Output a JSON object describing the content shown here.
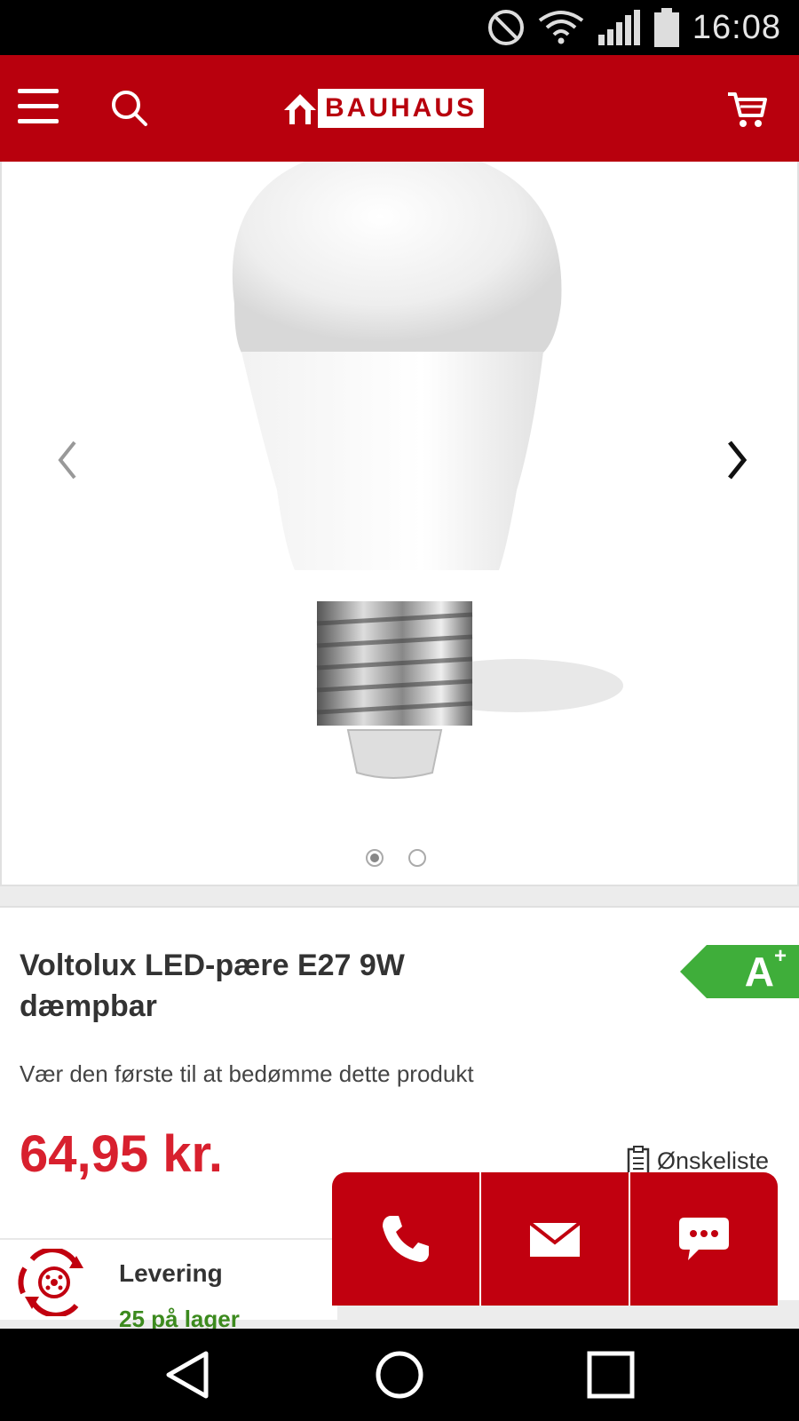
{
  "status_bar": {
    "time": "16:08",
    "icons": [
      "do-not-disturb-icon",
      "wifi-icon",
      "signal-icon",
      "battery-icon"
    ]
  },
  "header": {
    "brand": "BAUHAUS",
    "brand_color": "#b8000d",
    "icons": [
      "menu-icon",
      "search-icon",
      "cart-icon"
    ]
  },
  "carousel": {
    "current_slide": 1,
    "total_slides": 2
  },
  "product": {
    "title": "Voltolux LED-pære E27 9W dæmpbar",
    "energy_class": "A",
    "energy_class_suffix": "+",
    "energy_color": "#3fae3a",
    "rating_text": "Vær den første til at bedømme dette produkt",
    "price": "64,95 kr.",
    "price_color": "#d8202e",
    "wishlist_label": "Ønskeliste"
  },
  "delivery": {
    "title": "Levering",
    "stock": "25 på lager"
  },
  "contact": {
    "buttons": [
      "phone-icon",
      "mail-icon",
      "chat-icon"
    ]
  },
  "nav_bar": {
    "buttons": [
      "back-icon",
      "home-icon",
      "recents-icon"
    ]
  }
}
